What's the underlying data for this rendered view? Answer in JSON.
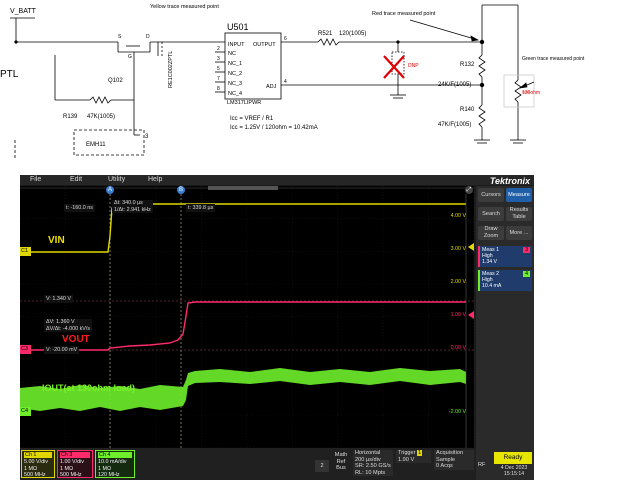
{
  "schematic": {
    "net_vbatt": "V_BATT",
    "net_ptl": "PTL",
    "q102_pin_s": "S",
    "q102_pin_d": "D",
    "q102_pin_g": "G",
    "q102_ref": "Q102",
    "q102_part": "RE1C002ZPTL",
    "r139_label": "R139",
    "r139_value": "47K(1005)",
    "emh_ref": "EMH11",
    "emh_pin3": "3",
    "u501_ref": "U501",
    "u501_part": "LM317LIPWR",
    "u501_pins_left": [
      "INPUT",
      "NC",
      "NC_1",
      "NC_2",
      "NC_3",
      "NC_4"
    ],
    "u501_pin_nums_left": [
      "2",
      "3",
      "5",
      "7",
      "8"
    ],
    "u501_output": "OUTPUT",
    "u501_adj": "ADJ",
    "u501_pin6": "6",
    "u501_pin4": "4",
    "r521_label": "R521",
    "r521_value": "120(1005)",
    "dnp": "DNP",
    "r132_label": "R132",
    "r132_value": "24K/F(1005)",
    "r140_label": "R140",
    "r140_value": "47K/F(1005)",
    "load": "130ohm",
    "icc_eq1": "Icc = VREF / R1",
    "icc_eq2": "Icc = 1.25V / 120ohm = 10.42mA",
    "ann_yellow": "Yellow trace measured point",
    "ann_red": "Red trace measured point",
    "ann_green": "Green trace measured point"
  },
  "scope": {
    "menu": [
      "File",
      "Edit",
      "Utility",
      "Help"
    ],
    "brand": "Tektronix",
    "cursor_a": "A",
    "cursor_b": "B",
    "readout_t": "t:  -160.0 ns",
    "readout_dt": "Δt:  340.0 µs",
    "readout_inv_dt": "1/Δt:  2.941 kHz",
    "readout_t2": "t:  339.8 µs",
    "readout_v": "V:  1.340 V",
    "readout_dv": "ΔV:  1.360 V",
    "readout_dvdt": "ΔV/Δt:  -4.000 kV/s",
    "readout_v2": "V:  -20.00 mV",
    "ch1_marker": "C1",
    "ch3_marker": "C3",
    "ch4_marker": "C4",
    "label_vin": "VIN",
    "label_vout": "VOUT",
    "label_iout": "IOUT(at 130ohm load)",
    "y_ch1": [
      "4.00 V",
      "3.00 V",
      "2.00 V"
    ],
    "y_ch3": [
      "1.00 V",
      "0.00 V"
    ],
    "y_ch4": [
      "-2.00 V"
    ],
    "colors": {
      "ch1": "#e0d800",
      "ch3": "#ff2a6a",
      "ch4": "#6eef2a",
      "vin_text": "#f0e000",
      "vout_text": "#ff1a1a",
      "iout_text": "#7cf22c"
    }
  },
  "right_panel": {
    "cursors": "Cursors",
    "measure": "Measure",
    "search": "Search",
    "results_table": "Results Table",
    "draw_zoom": "Draw Zoom",
    "more": "More ...",
    "meas1_title": "Meas 1",
    "meas1_badge": "3",
    "meas1_type": "High",
    "meas1_value": "1.34 V",
    "meas2_title": "Meas 2",
    "meas2_badge": "4",
    "meas2_type": "High",
    "meas2_value": "10.4 mA"
  },
  "bottom_bar": {
    "ch1": {
      "title": "Ch 1",
      "scale": "5.00 V/div",
      "coupling": "1 MΩ",
      "bw": "500 MHz"
    },
    "ch3": {
      "title": "Ch 3",
      "scale": "1.00 V/div",
      "coupling": "1 MΩ",
      "bw": "500 MHz"
    },
    "ch4": {
      "title": "Ch 4",
      "scale": "10.0 mA/div",
      "coupling": "1 MΩ",
      "bw": "120 MHz"
    },
    "num2": "2",
    "math_ref_bus": [
      "Math",
      "Ref",
      "Bus"
    ],
    "horizontal_title": "Horizontal",
    "horizontal": [
      "200 µs/div",
      "SR: 2.50 GS/s",
      "RL: 10 Mpts"
    ],
    "trigger_title": "Trigger",
    "trigger_badge": "1",
    "trigger_level": "1.90 V",
    "acq_title": "Acquisition",
    "acq": [
      "Sample",
      "0 Acqs"
    ],
    "rf": "RF",
    "ready": "Ready",
    "date": "4 Dec 2023",
    "time": "15:15:14"
  }
}
